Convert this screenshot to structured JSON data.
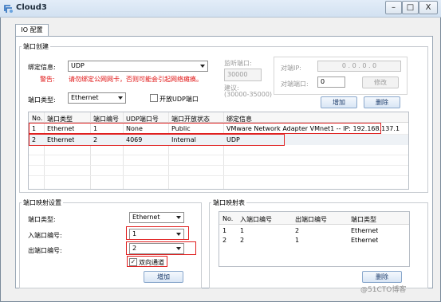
{
  "window": {
    "title": "Cloud3",
    "minimize_glyph": "–",
    "maximize_glyph": "□",
    "close_glyph": "X"
  },
  "tab": {
    "label": "IO 配置"
  },
  "port_create": {
    "title": "端口创建",
    "bind_label": "绑定信息:",
    "bind_value": "UDP",
    "warning_prefix": "警告:",
    "warning_text": "请勿绑定公网网卡，否则可能会引起网络瘫痪。",
    "port_type_label": "端口类型:",
    "port_type_value": "Ethernet",
    "open_udp_label": "开放UDP端口",
    "open_udp_checked": false,
    "listen_port_label": "监听端口:",
    "listen_port_value": "30000",
    "suggest_label": "建议:",
    "suggest_range": "(30000-35000)",
    "peer_ip_label": "对端IP:",
    "peer_ip_value": "0 . 0 . 0 . 0",
    "peer_port_label": "对端端口:",
    "peer_port_value": "0",
    "modify_button": "修改",
    "add_button": "增加",
    "delete_button": "删除"
  },
  "port_table": {
    "headers": [
      "No.",
      "端口类型",
      "端口编号",
      "UDP端口号",
      "端口开放状态",
      "绑定信息"
    ],
    "rows": [
      [
        "1",
        "Ethernet",
        "1",
        "None",
        "Public",
        "VMware Network Adapter VMnet1 -- IP: 192.168.137.1"
      ],
      [
        "2",
        "Ethernet",
        "2",
        "4069",
        "Internal",
        "UDP"
      ]
    ]
  },
  "mapping_settings": {
    "title": "端口映射设置",
    "port_type_label": "端口类型:",
    "port_type_value": "Ethernet",
    "in_port_label": "入端口编号:",
    "in_port_value": "1",
    "out_port_label": "出端口编号:",
    "out_port_value": "2",
    "bidirectional_label": "双向通道",
    "bidirectional_checked": true,
    "add_button": "增加"
  },
  "mapping_table": {
    "title": "端口映射表",
    "headers": [
      "No.",
      "入端口编号",
      "出端口编号",
      "端口类型"
    ],
    "rows": [
      [
        "1",
        "1",
        "2",
        "Ethernet"
      ],
      [
        "2",
        "2",
        "1",
        "Ethernet"
      ]
    ],
    "delete_button": "删除"
  },
  "watermark": "@51CTO博客",
  "colors": {
    "warning": "#e01010",
    "highlight": "#e02020",
    "button_text": "#1a3a6a"
  }
}
